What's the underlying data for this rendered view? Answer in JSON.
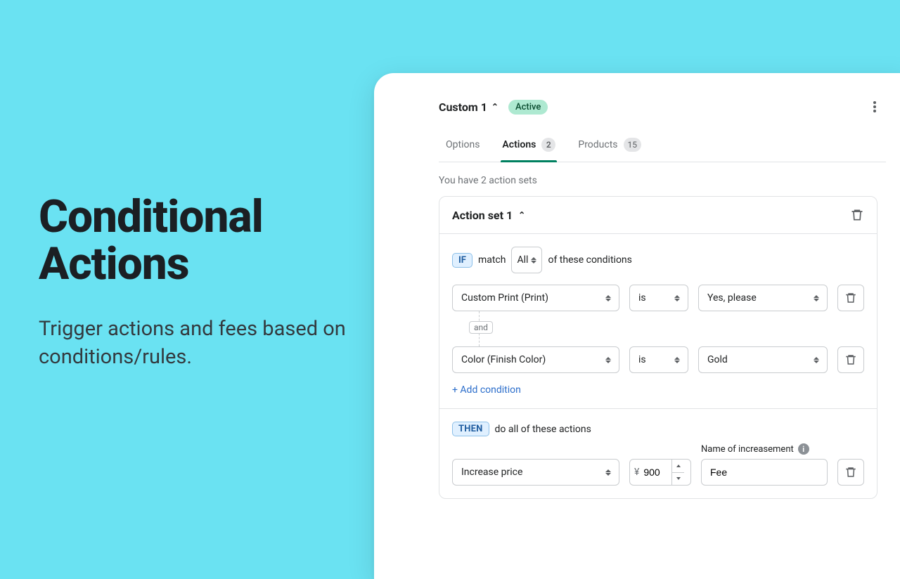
{
  "promo": {
    "heading": "Conditional Actions",
    "sub": "Trigger actions and fees based on conditions/rules."
  },
  "header": {
    "title": "Custom 1",
    "status": "Active"
  },
  "tabs": {
    "options": "Options",
    "actions": "Actions",
    "actions_count": "2",
    "products": "Products",
    "products_count": "15"
  },
  "summary": "You have 2 action sets",
  "set": {
    "title": "Action set 1",
    "if_label": "IF",
    "match_word": "match",
    "match_mode": "All",
    "of_these": "of these conditions",
    "conditions": [
      {
        "field": "Custom Print (Print)",
        "op": "is",
        "value": "Yes, please"
      },
      {
        "field": "Color (Finish Color)",
        "op": "is",
        "value": "Gold"
      }
    ],
    "and_label": "and",
    "add_condition": "+ Add condition",
    "then_label": "THEN",
    "do_all": "do all of these actions",
    "action": {
      "type": "Increase price",
      "currency": "¥",
      "amount": "900",
      "name_label": "Name of increasement",
      "name_value": "Fee"
    }
  }
}
